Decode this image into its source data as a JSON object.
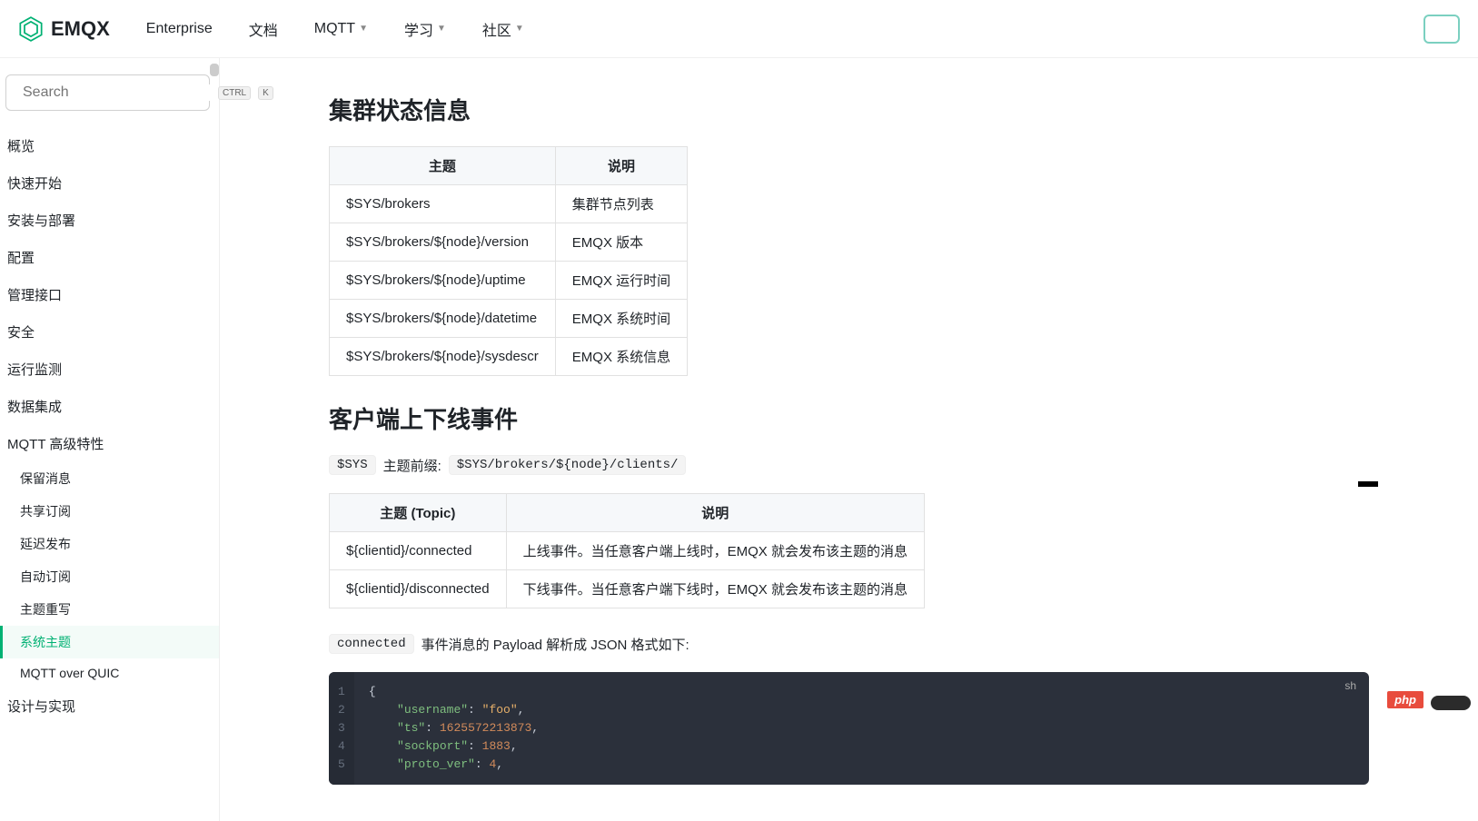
{
  "header": {
    "brand": "EMQX",
    "nav": [
      "Enterprise",
      "文档",
      "MQTT",
      "学习",
      "社区"
    ]
  },
  "search": {
    "placeholder": "Search",
    "kbd1": "CTRL",
    "kbd2": "K"
  },
  "sidebar": {
    "items": [
      "概览",
      "快速开始",
      "安装与部署",
      "配置",
      "管理接口",
      "安全",
      "运行监测",
      "数据集成",
      "MQTT 高级特性"
    ],
    "subs": [
      "保留消息",
      "共享订阅",
      "延迟发布",
      "自动订阅",
      "主题重写",
      "系统主题",
      "MQTT over QUIC"
    ],
    "active_sub_index": 5,
    "tail": [
      "设计与实现"
    ]
  },
  "section1": {
    "title": "集群状态信息",
    "headers": [
      "主题",
      "说明"
    ],
    "rows": [
      [
        "$SYS/brokers",
        "集群节点列表"
      ],
      [
        "$SYS/brokers/${node}/version",
        "EMQX 版本"
      ],
      [
        "$SYS/brokers/${node}/uptime",
        "EMQX 运行时间"
      ],
      [
        "$SYS/brokers/${node}/datetime",
        "EMQX 系统时间"
      ],
      [
        "$SYS/brokers/${node}/sysdescr",
        "EMQX 系统信息"
      ]
    ]
  },
  "section2": {
    "title": "客户端上下线事件",
    "prefix_code1": "$SYS",
    "prefix_label": "主题前缀:",
    "prefix_code2": "$SYS/brokers/${node}/clients/",
    "headers": [
      "主题 (Topic)",
      "说明"
    ],
    "rows": [
      [
        "${clientid}/connected",
        "上线事件。当任意客户端上线时，EMQX 就会发布该主题的消息"
      ],
      [
        "${clientid}/disconnected",
        "下线事件。当任意客户端下线时，EMQX 就会发布该主题的消息"
      ]
    ],
    "payload_code": "connected",
    "payload_text": "事件消息的 Payload 解析成 JSON 格式如下:"
  },
  "code": {
    "lang": "sh",
    "lines": [
      [
        {
          "t": "punc",
          "v": "{"
        }
      ],
      [
        {
          "t": "indent",
          "v": "    "
        },
        {
          "t": "key",
          "v": "\"username\""
        },
        {
          "t": "punc",
          "v": ": "
        },
        {
          "t": "str",
          "v": "\"foo\""
        },
        {
          "t": "punc",
          "v": ","
        }
      ],
      [
        {
          "t": "indent",
          "v": "    "
        },
        {
          "t": "key",
          "v": "\"ts\""
        },
        {
          "t": "punc",
          "v": ": "
        },
        {
          "t": "num",
          "v": "1625572213873"
        },
        {
          "t": "punc",
          "v": ","
        }
      ],
      [
        {
          "t": "indent",
          "v": "    "
        },
        {
          "t": "key",
          "v": "\"sockport\""
        },
        {
          "t": "punc",
          "v": ": "
        },
        {
          "t": "num",
          "v": "1883"
        },
        {
          "t": "punc",
          "v": ","
        }
      ],
      [
        {
          "t": "indent",
          "v": "    "
        },
        {
          "t": "key",
          "v": "\"proto_ver\""
        },
        {
          "t": "punc",
          "v": ": "
        },
        {
          "t": "num",
          "v": "4"
        },
        {
          "t": "punc",
          "v": ","
        }
      ]
    ]
  },
  "badges": {
    "php": "php"
  }
}
